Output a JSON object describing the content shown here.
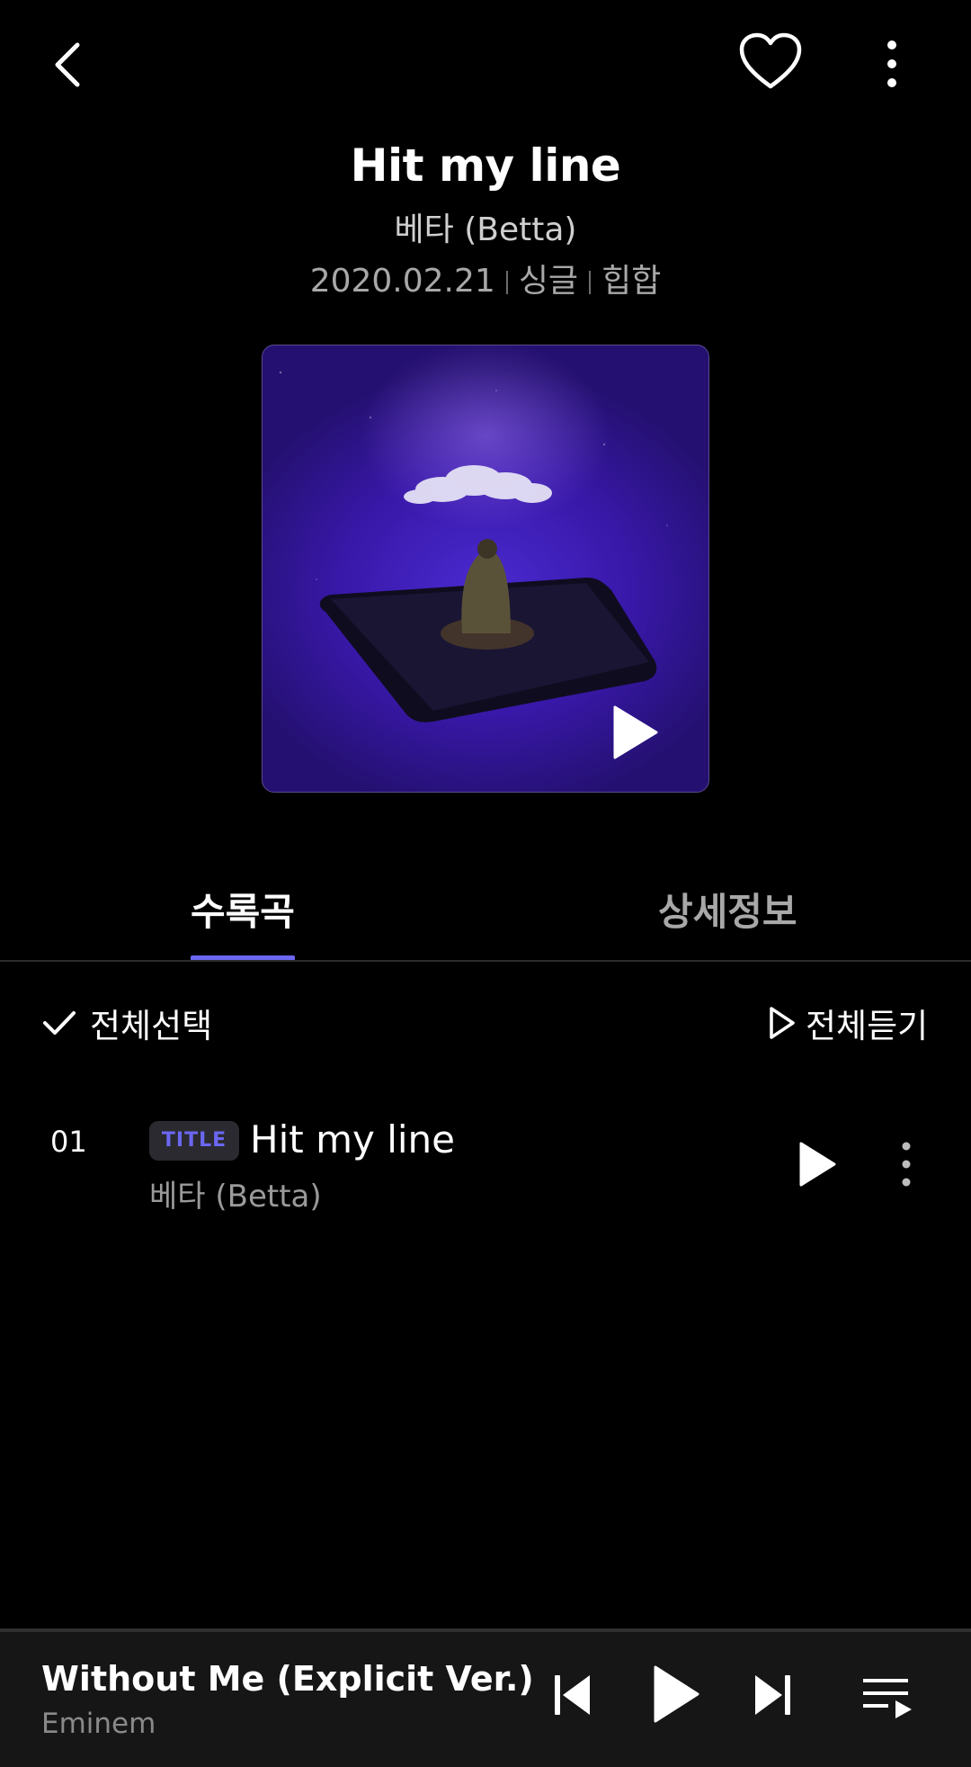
{
  "header": {
    "back_icon": "chevron-left-icon",
    "like_icon": "heart-outline-icon",
    "more_icon": "vertical-dots-icon"
  },
  "album": {
    "title": "Hit my line",
    "artist": "베타 (Betta)",
    "date": "2020.02.21",
    "type": "싱글",
    "genre": "힙합",
    "cover_play_icon": "play-icon"
  },
  "tabs": [
    {
      "label": "수록곡",
      "active": true
    },
    {
      "label": "상세정보",
      "active": false
    }
  ],
  "actions": {
    "select_all": "전체선택",
    "play_all": "전체듣기"
  },
  "tracks": [
    {
      "number": "01",
      "badge": "TITLE",
      "title": "Hit my line",
      "artist": "베타 (Betta)"
    }
  ],
  "player": {
    "title": "Without Me (Explicit Ver.)",
    "artist": "Eminem"
  },
  "colors": {
    "accent": "#6b67f0",
    "background": "#000000",
    "mini_player_bg": "#161616"
  }
}
